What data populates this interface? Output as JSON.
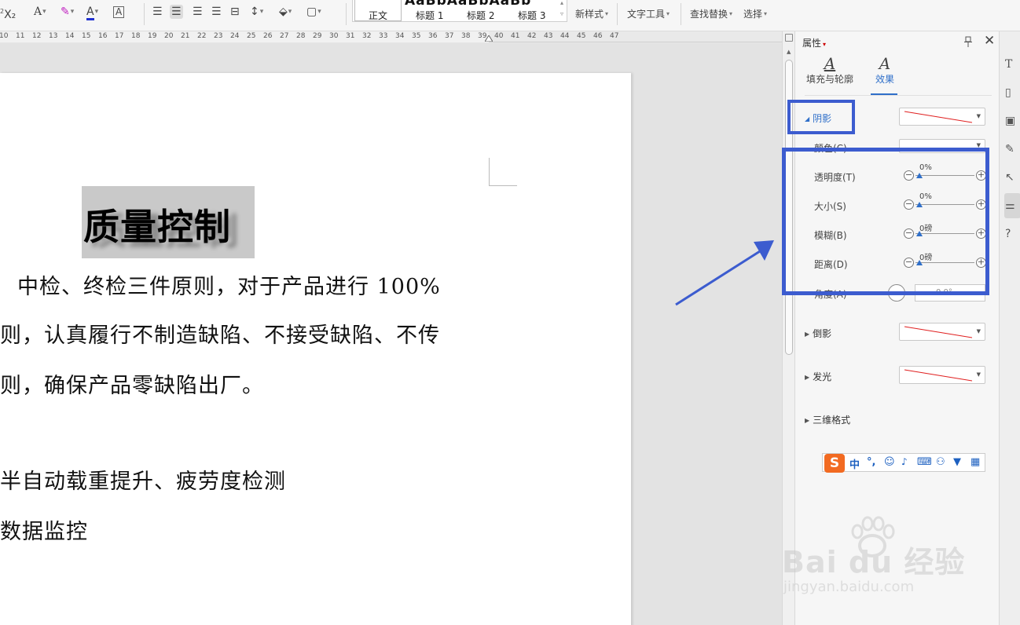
{
  "toolbar": {
    "font_tools": [
      "X₂",
      "A",
      "A",
      "A",
      "A"
    ],
    "styles": {
      "preview_text": "AaBbAaBbAaBb",
      "normal": "正文",
      "heading1": "标题 1",
      "heading2": "标题 2",
      "heading3": "标题 3"
    },
    "new_style": "新样式",
    "text_tools": "文字工具",
    "find_replace": "查找替换",
    "select": "选择"
  },
  "ruler": {
    "ticks": [
      "10",
      "11",
      "12",
      "13",
      "14",
      "15",
      "16",
      "17",
      "18",
      "19",
      "20",
      "21",
      "22",
      "23",
      "24",
      "25",
      "26",
      "27",
      "28",
      "29",
      "30",
      "31",
      "32",
      "33",
      "34",
      "35",
      "36",
      "37",
      "38",
      "39",
      "40",
      "41",
      "42",
      "43",
      "44",
      "45",
      "46",
      "47"
    ]
  },
  "document": {
    "title": "质量控制",
    "paragraphs": [
      "中检、终检三件原则，对于产品进行 100%",
      "则，认真履行不制造缺陷、不接受缺陷、不传",
      "则，确保产品零缺陷出厂。",
      "半自动载重提升、疲劳度检测",
      "数据监控"
    ]
  },
  "panel": {
    "title": "属性",
    "tabs": [
      {
        "label": "填充与轮廓",
        "glyph": "A"
      },
      {
        "label": "效果",
        "glyph": "A"
      }
    ],
    "shadow_section": "阴影",
    "color_label": "颜色(C)",
    "rows": [
      {
        "label": "透明度(T)",
        "value": "0%"
      },
      {
        "label": "大小(S)",
        "value": "0%"
      },
      {
        "label": "模糊(B)",
        "value": "0磅"
      },
      {
        "label": "距离(D)",
        "value": "0磅"
      }
    ],
    "angle_label": "角度(A)",
    "angle_value": "0.0°",
    "reflection": "倒影",
    "glow": "发光",
    "three_d": "三维格式"
  },
  "ime": {
    "logo": "S",
    "items": [
      "中",
      "°,",
      "☺",
      "🎤",
      "⌨",
      "⚇",
      "👕",
      "▦"
    ]
  },
  "watermark": {
    "text": "Bai du 经验",
    "url": "jingyan.baidu.com"
  },
  "colors": {
    "accent": "#2f6fc9",
    "highlight": "#3c5ccf",
    "ime_logo": "#f26a21"
  }
}
